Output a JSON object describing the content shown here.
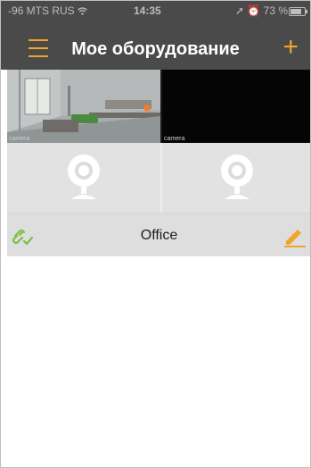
{
  "status_bar": {
    "carrier": "-96 MTS RUS",
    "time": "14:35",
    "battery": "73 %",
    "battery_level": 0.73
  },
  "navbar": {
    "title": "Мое оборудование",
    "menu_icon": "hamburger-menu-icon",
    "add_icon": "plus-icon",
    "add_label": "+"
  },
  "previews": {
    "left_tag": "camera",
    "right_tag": "camera"
  },
  "tiles": [
    {
      "icon": "webcam-icon"
    },
    {
      "icon": "webcam-icon"
    }
  ],
  "group": {
    "name": "Office",
    "status_icon": "link-connected-icon",
    "edit_icon": "pencil-icon"
  },
  "colors": {
    "accent": "#f2a52c",
    "header_bg": "#4b4a4a",
    "connected": "#7bc043"
  }
}
